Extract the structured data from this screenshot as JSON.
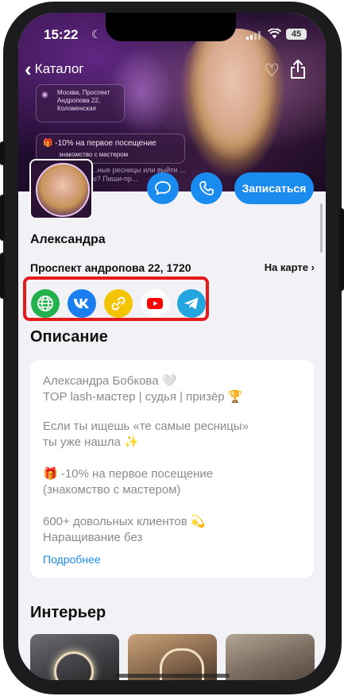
{
  "status_bar": {
    "time": "15:22",
    "battery": "45"
  },
  "nav": {
    "back_label": "Каталог"
  },
  "hero_overlay": {
    "address_lines": [
      "Москва, Проспект",
      "Андропова 22,",
      "Коломенская"
    ],
    "discount_line1": "-10% на первое посещение",
    "discount_line2": "знакомство с мастером",
    "lash_text": "...ные ресницы или выйти ... ю? Пиши-пр..."
  },
  "actions": {
    "book_label": "Записаться"
  },
  "master": {
    "name": "Александра",
    "address": "Проспект андропова 22, 1720",
    "map_link": "На карте"
  },
  "socials": [
    {
      "name": "website",
      "icon": "globe-icon",
      "color": "#22b14c"
    },
    {
      "name": "vk",
      "icon": "vk-icon",
      "color": "#1a7ef0"
    },
    {
      "name": "link",
      "icon": "link-icon",
      "color": "#f5c400"
    },
    {
      "name": "youtube",
      "icon": "youtube-icon",
      "color": "#ffffff"
    },
    {
      "name": "telegram",
      "icon": "telegram-icon",
      "color": "#23a6e0"
    }
  ],
  "description": {
    "heading": "Описание",
    "paragraphs": [
      "Александра Бобкова 🤍\nTOP lash-мастер | судья | призёр 🏆",
      "Если ты ищешь «те самые ресницы»\nты уже нашла ✨",
      "🎁 -10% на первое посещение\n(знакомство с мастером)",
      "600+ довольных клиентов 💫\nНаращивание без"
    ],
    "more_label": "Подробнее"
  },
  "interior": {
    "heading": "Интерьер"
  },
  "colors": {
    "accent": "#1a8cf0",
    "highlight": "#e51a1a"
  }
}
